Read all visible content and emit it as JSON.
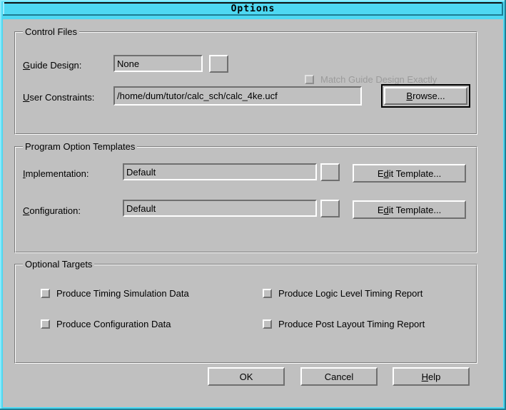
{
  "window": {
    "title": "Options",
    "titlebar_color": "#4ed8f2",
    "face_color": "#c0c0c0"
  },
  "groups": {
    "control_files": {
      "caption": "Control Files",
      "guide_design": {
        "label_pre": "",
        "label_mnemonic": "G",
        "label_post": "uide Design:",
        "value": "None"
      },
      "match_guide": {
        "label": "Match Guide Design Exactly",
        "checked": false,
        "enabled": false
      },
      "user_constraints": {
        "label_mnemonic": "U",
        "label_post": "ser Constraints:",
        "value": "/home/dum/tutor/calc_sch/calc_4ke.ucf"
      },
      "browse_button": {
        "mnemonic": "B",
        "post": "rowse...",
        "is_default": true
      }
    },
    "program_option_templates": {
      "caption": "Program Option Templates",
      "implementation": {
        "label_mnemonic": "I",
        "label_post": "mplementation:",
        "value": "Default",
        "button_pre": "E",
        "button_mnemonic": "d",
        "button_post": "it Template..."
      },
      "configuration": {
        "label_mnemonic": "C",
        "label_post": "onfiguration:",
        "value": "Default",
        "button_pre": "E",
        "button_mnemonic": "d",
        "button_post": "it Template..."
      }
    },
    "optional_targets": {
      "caption": "Optional Targets",
      "checkboxes": [
        {
          "label": "Produce Timing Simulation Data",
          "checked": false,
          "enabled": true
        },
        {
          "label": "Produce Logic Level Timing Report",
          "checked": false,
          "enabled": true
        },
        {
          "label": "Produce Configuration Data",
          "checked": false,
          "enabled": true
        },
        {
          "label": "Produce Post Layout Timing Report",
          "checked": false,
          "enabled": true
        }
      ]
    }
  },
  "footer": {
    "ok": "OK",
    "cancel": "Cancel",
    "help_mnemonic": "H",
    "help_post": "elp"
  },
  "icons": {
    "dropdown": "chevron-down-icon"
  }
}
